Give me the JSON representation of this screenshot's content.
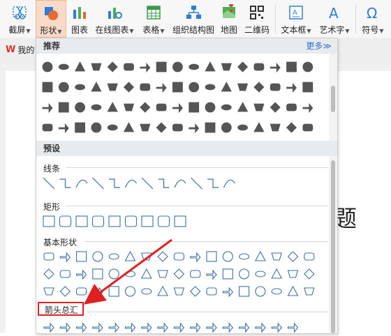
{
  "ribbon": {
    "items": [
      {
        "label": "截屏",
        "caret": true
      },
      {
        "label": "形状",
        "caret": true
      },
      {
        "label": "图表"
      },
      {
        "label": "在线图表",
        "caret": true
      },
      {
        "label": "表格",
        "caret": true
      },
      {
        "label": "组织结构图"
      },
      {
        "label": "地图"
      },
      {
        "label": "二维码"
      },
      {
        "label": "文本框",
        "caret": true
      },
      {
        "label": "艺术字",
        "caret": true
      },
      {
        "label": "符号",
        "caret": true
      }
    ],
    "active": "形状",
    "accent": "#efb596"
  },
  "doc_tab": {
    "label": "我的"
  },
  "document": {
    "title_fragment": "题"
  },
  "panel": {
    "recommended_label": "推荐",
    "more_label": "更多≫",
    "preset_label": "预设",
    "categories": [
      "线条",
      "矩形",
      "基本形状",
      "箭头总汇"
    ],
    "highlight_category": "箭头总汇",
    "highlight_color": "#e02020"
  }
}
